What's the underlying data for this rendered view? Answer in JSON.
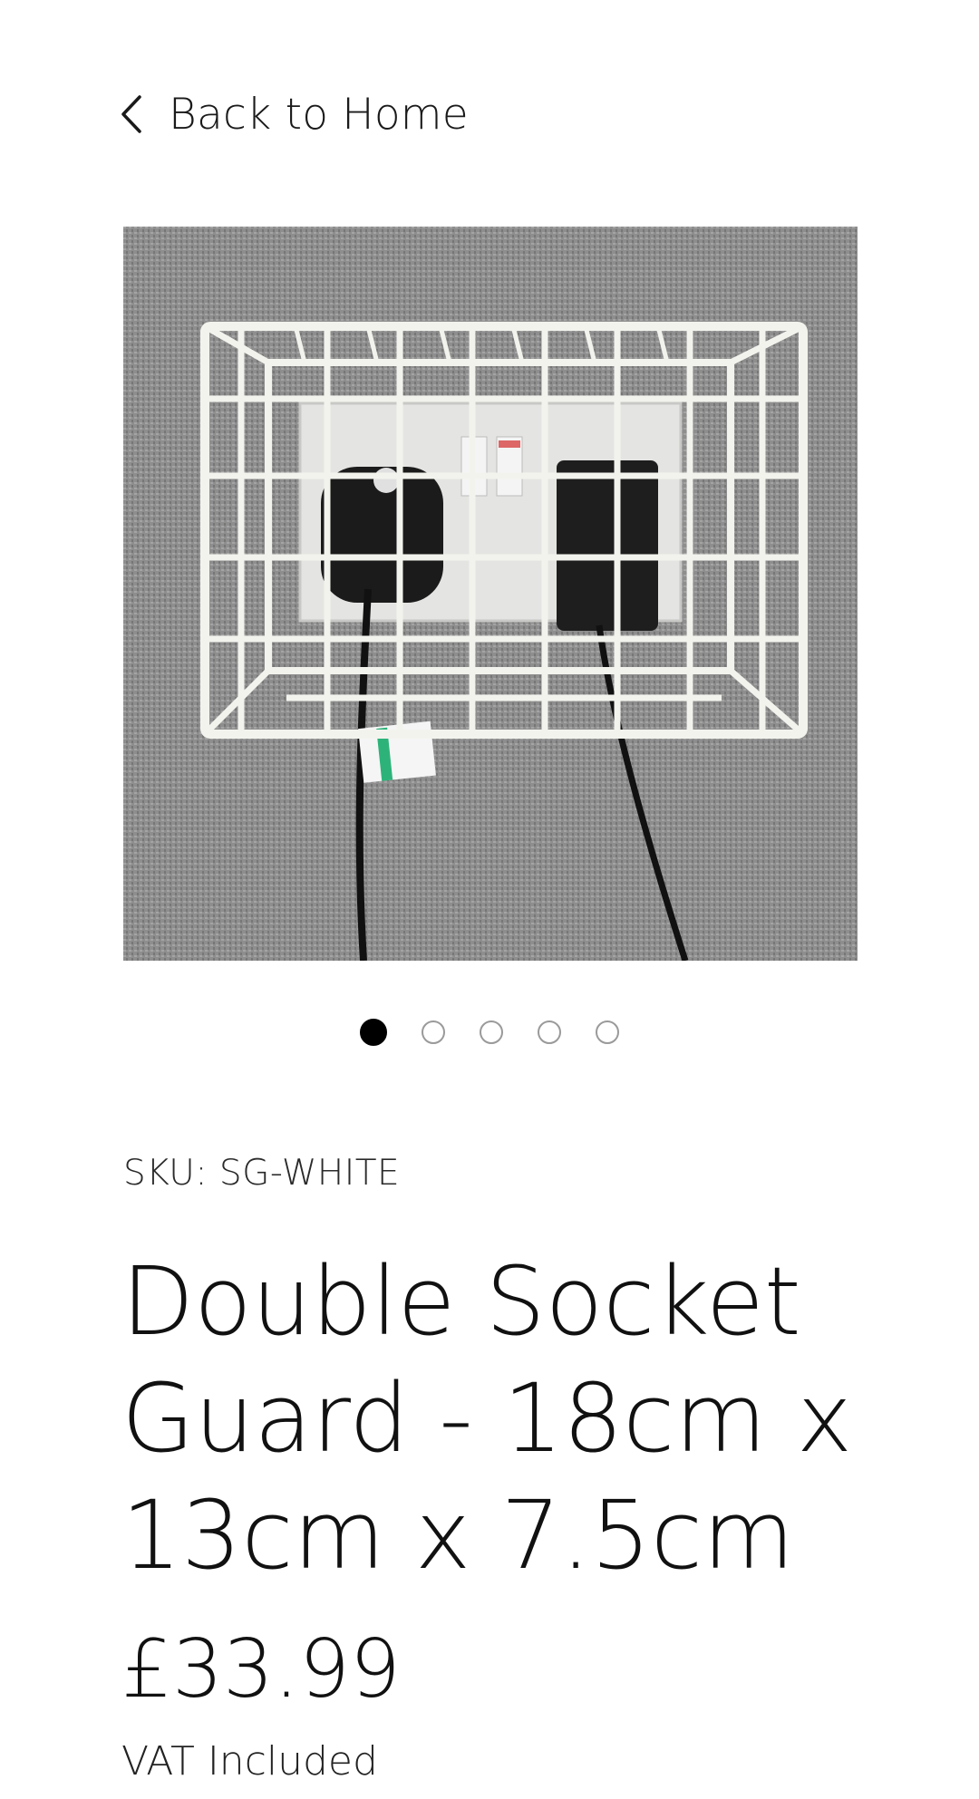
{
  "nav": {
    "back_label": "Back to Home",
    "back_icon": "chevron-left-icon"
  },
  "gallery": {
    "image_alt": "White wire cage guard fitted over a double wall socket with two plugs",
    "slide_count": 5,
    "active_index": 0
  },
  "product": {
    "sku": "SKU: SG-WHITE",
    "title": "Double Socket Guard - 18cm x 13cm x 7.5cm",
    "price": "£33.99",
    "vat_note": "VAT Included"
  },
  "colors": {
    "text": "#111111",
    "dot_active": "#000000",
    "dot_inactive": "#9a9a9a",
    "cage": "#f3f3ee",
    "wall": "#8f8f8f"
  }
}
